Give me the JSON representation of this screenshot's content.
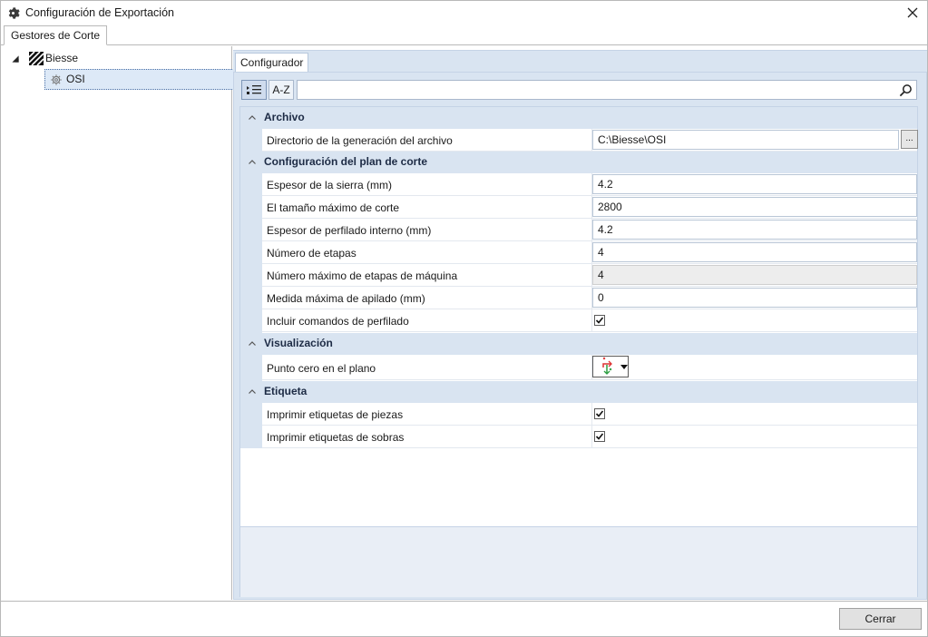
{
  "window": {
    "title": "Configuración de Exportación",
    "title_icon": "gear-icon",
    "close_icon": "close-icon"
  },
  "outer_tab": {
    "label": "Gestores de Corte"
  },
  "tree": {
    "root": {
      "label": "Biesse",
      "icon": "biesse-logo-icon",
      "expanded": true
    },
    "child": {
      "label": "OSI",
      "icon": "gear-icon",
      "selected": true
    }
  },
  "inner_tab": {
    "label": "Configurador"
  },
  "toolbar": {
    "categorized_icon": "categorized-icon",
    "alpha_label": "A-Z",
    "search_placeholder": "",
    "search_icon": "search-icon"
  },
  "categories": [
    {
      "label": "Archivo",
      "rows": [
        {
          "name": "Directorio de la generación del archivo",
          "type": "path",
          "value": "C:\\Biesse\\OSI",
          "button": "..."
        }
      ]
    },
    {
      "label": "Configuración del plan de corte",
      "rows": [
        {
          "name": "Espesor de la sierra (mm)",
          "type": "text",
          "value": "4.2"
        },
        {
          "name": "El tamaño máximo de corte",
          "type": "text",
          "value": "2800"
        },
        {
          "name": "Espesor de perfilado interno (mm)",
          "type": "text",
          "value": "4.2"
        },
        {
          "name": "Número de etapas",
          "type": "text",
          "value": "4"
        },
        {
          "name": "Número máximo de etapas de máquina",
          "type": "readonly",
          "value": "4"
        },
        {
          "name": "Medida máxima de apilado (mm)",
          "type": "text",
          "value": "0"
        },
        {
          "name": "Incluir comandos de perfilado",
          "type": "checkbox",
          "checked": true
        }
      ]
    },
    {
      "label": "Visualización",
      "rows": [
        {
          "name": "Punto cero en el plano",
          "type": "zero-point",
          "icon": "zero-point-icon"
        }
      ]
    },
    {
      "label": "Etiqueta",
      "rows": [
        {
          "name": "Imprimir etiquetas de piezas",
          "type": "checkbox",
          "checked": true
        },
        {
          "name": "Imprimir etiquetas de sobras",
          "type": "checkbox",
          "checked": true
        }
      ]
    }
  ],
  "footer": {
    "close_label": "Cerrar"
  },
  "colors": {
    "accent": "#d9e4f1",
    "selection": "#dde9f7",
    "category_text": "#1d2b45"
  }
}
